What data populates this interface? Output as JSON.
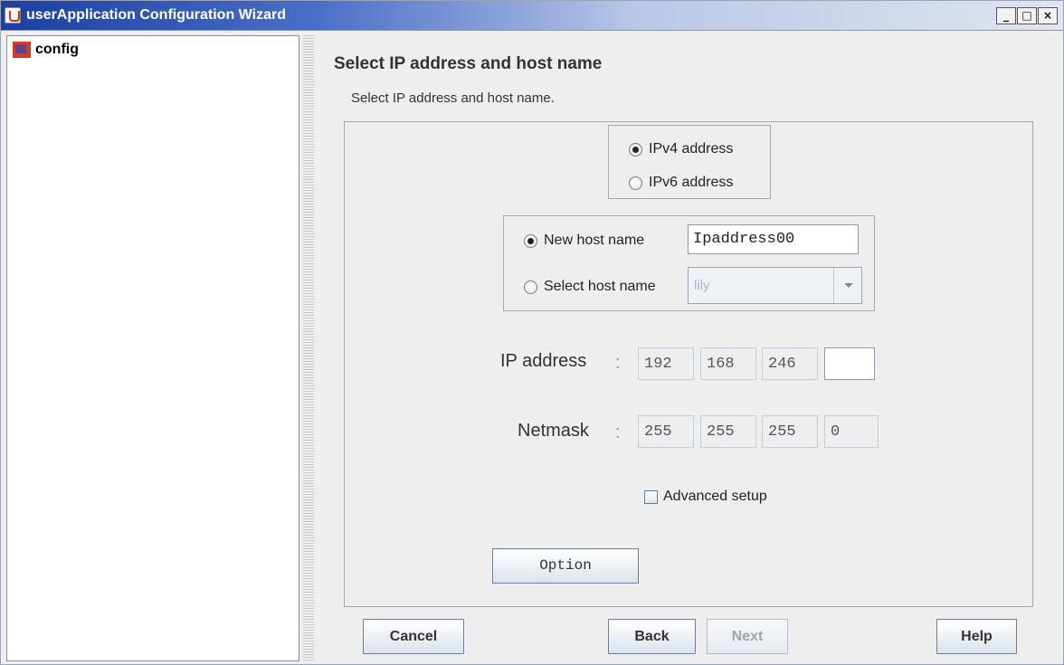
{
  "window": {
    "title": "userApplication Configuration Wizard",
    "controls": {
      "minimize": "_",
      "maximize": "□",
      "close": "×"
    }
  },
  "tree": {
    "root_label": "config",
    "root_icon": "config-node-icon"
  },
  "page": {
    "title": "Select IP address and host name",
    "description": "Select IP address and host name."
  },
  "ip_version": {
    "options": [
      {
        "label": "IPv4 address",
        "selected": true
      },
      {
        "label": "IPv6 address",
        "selected": false
      }
    ]
  },
  "host": {
    "new_host_label": "New host name",
    "new_host_selected": true,
    "new_host_value": "Ipaddress00",
    "select_host_label": "Select host name",
    "select_host_selected": false,
    "select_host_value": "lily"
  },
  "ip": {
    "label": "IP address",
    "separator": ":",
    "octets": [
      "192",
      "168",
      "246",
      ""
    ]
  },
  "netmask": {
    "label": "Netmask",
    "separator": ":",
    "octets": [
      "255",
      "255",
      "255",
      "0"
    ]
  },
  "advanced": {
    "label": "Advanced setup",
    "checked": false
  },
  "buttons": {
    "option": "Option",
    "cancel": "Cancel",
    "back": "Back",
    "next": "Next",
    "help": "Help"
  }
}
